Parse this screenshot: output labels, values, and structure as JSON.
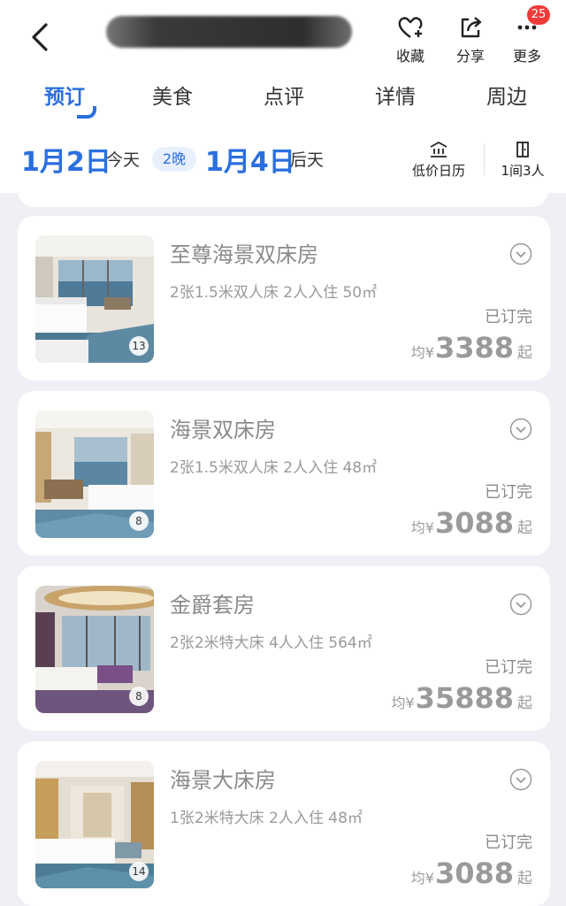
{
  "header": {
    "actions": [
      {
        "label": "收藏",
        "icon": "heart-plus-icon"
      },
      {
        "label": "分享",
        "icon": "share-icon"
      },
      {
        "label": "更多",
        "icon": "more-icon",
        "badge": "25"
      }
    ]
  },
  "tabs": [
    "预订",
    "美食",
    "点评",
    "详情",
    "周边"
  ],
  "dates": {
    "checkin": "1月2日",
    "checkin_sub": "今天",
    "nights": "2晚",
    "checkout": "1月4日",
    "checkout_sub": "后天",
    "calendar_label": "低价日历",
    "guests_label": "1间3人"
  },
  "rooms": [
    {
      "name": "至尊海景双床房",
      "spec": "2张1.5米双人床  2人入住  50㎡",
      "status": "已订完",
      "price_prefix": "均",
      "currency": "¥",
      "price": "3388",
      "price_suffix": "起",
      "photos": "13"
    },
    {
      "name": "海景双床房",
      "spec": "2张1.5米双人床  2人入住  48㎡",
      "status": "已订完",
      "price_prefix": "均",
      "currency": "¥",
      "price": "3088",
      "price_suffix": "起",
      "photos": "8"
    },
    {
      "name": "金爵套房",
      "spec": "2张2米特大床  4人入住  564㎡",
      "status": "已订完",
      "price_prefix": "均",
      "currency": "¥",
      "price": "35888",
      "price_suffix": "起",
      "photos": "8"
    },
    {
      "name": "海景大床房",
      "spec": "1张2米特大床  2人入住  48㎡",
      "status": "已订完",
      "price_prefix": "均",
      "currency": "¥",
      "price": "3088",
      "price_suffix": "起",
      "photos": "14"
    }
  ],
  "colors": {
    "accent": "#2a6fe0",
    "badge": "#f03a3a",
    "background": "#eef0f5"
  }
}
